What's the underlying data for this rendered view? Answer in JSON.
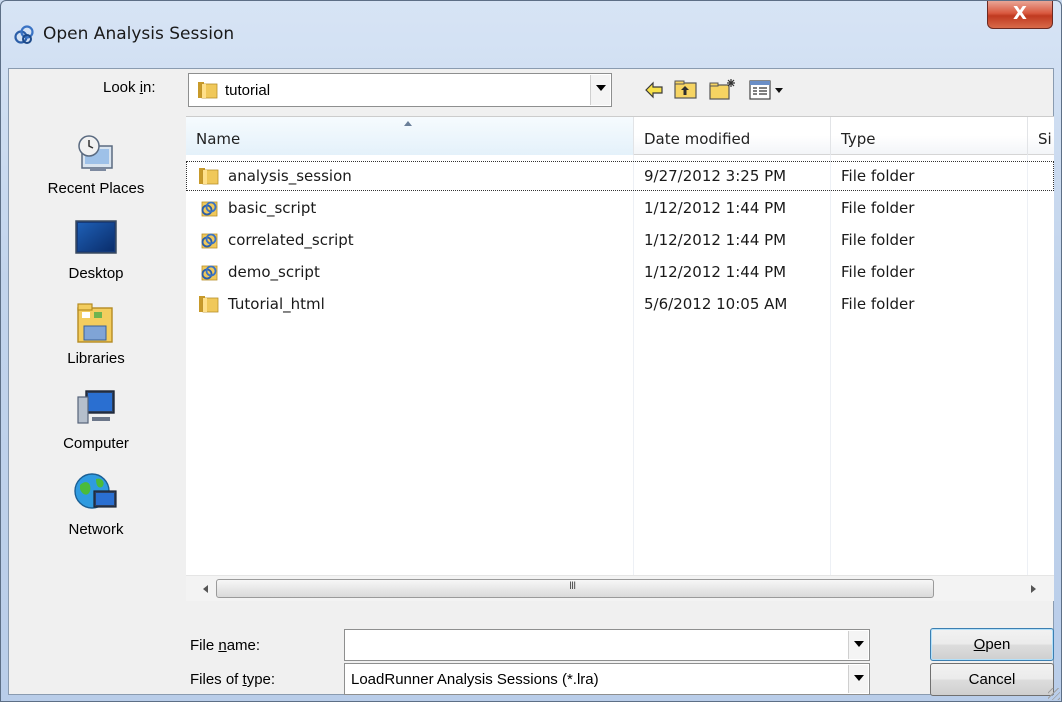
{
  "window": {
    "title": "Open Analysis Session",
    "close_label": "X"
  },
  "lookin": {
    "label": "Look in:",
    "label_pre": "Look ",
    "label_access": "i",
    "label_post": "n:",
    "value": "tutorial"
  },
  "toolbar": {
    "back_icon": "back-arrow-icon",
    "up_icon": "up-folder-icon",
    "new_folder_icon": "new-folder-icon",
    "views_icon": "views-menu-icon"
  },
  "places": [
    {
      "label": "Recent Places",
      "icon": "recent-places-icon"
    },
    {
      "label": "Desktop",
      "icon": "desktop-icon"
    },
    {
      "label": "Libraries",
      "icon": "libraries-icon"
    },
    {
      "label": "Computer",
      "icon": "computer-icon"
    },
    {
      "label": "Network",
      "icon": "network-icon"
    }
  ],
  "columns": {
    "name": "Name",
    "date": "Date modified",
    "type": "Type",
    "size": "Si"
  },
  "files": [
    {
      "name": "analysis_session",
      "date": "9/27/2012 3:25 PM",
      "type": "File folder",
      "icon": "folder-icon"
    },
    {
      "name": "basic_script",
      "date": "1/12/2012 1:44 PM",
      "type": "File folder",
      "icon": "script-folder-icon"
    },
    {
      "name": "correlated_script",
      "date": "1/12/2012 1:44 PM",
      "type": "File folder",
      "icon": "script-folder-icon"
    },
    {
      "name": "demo_script",
      "date": "1/12/2012 1:44 PM",
      "type": "File folder",
      "icon": "script-folder-icon"
    },
    {
      "name": "Tutorial_html",
      "date": "5/6/2012 10:05 AM",
      "type": "File folder",
      "icon": "folder-icon"
    }
  ],
  "filename": {
    "label_pre": "File ",
    "label_access": "n",
    "label_post": "ame:",
    "value": ""
  },
  "filetype": {
    "label_pre": "Files of ",
    "label_access": "t",
    "label_post": "ype:",
    "value": "LoadRunner Analysis Sessions (*.lra)"
  },
  "buttons": {
    "open_access": "O",
    "open_rest": "pen",
    "cancel": "Cancel"
  }
}
